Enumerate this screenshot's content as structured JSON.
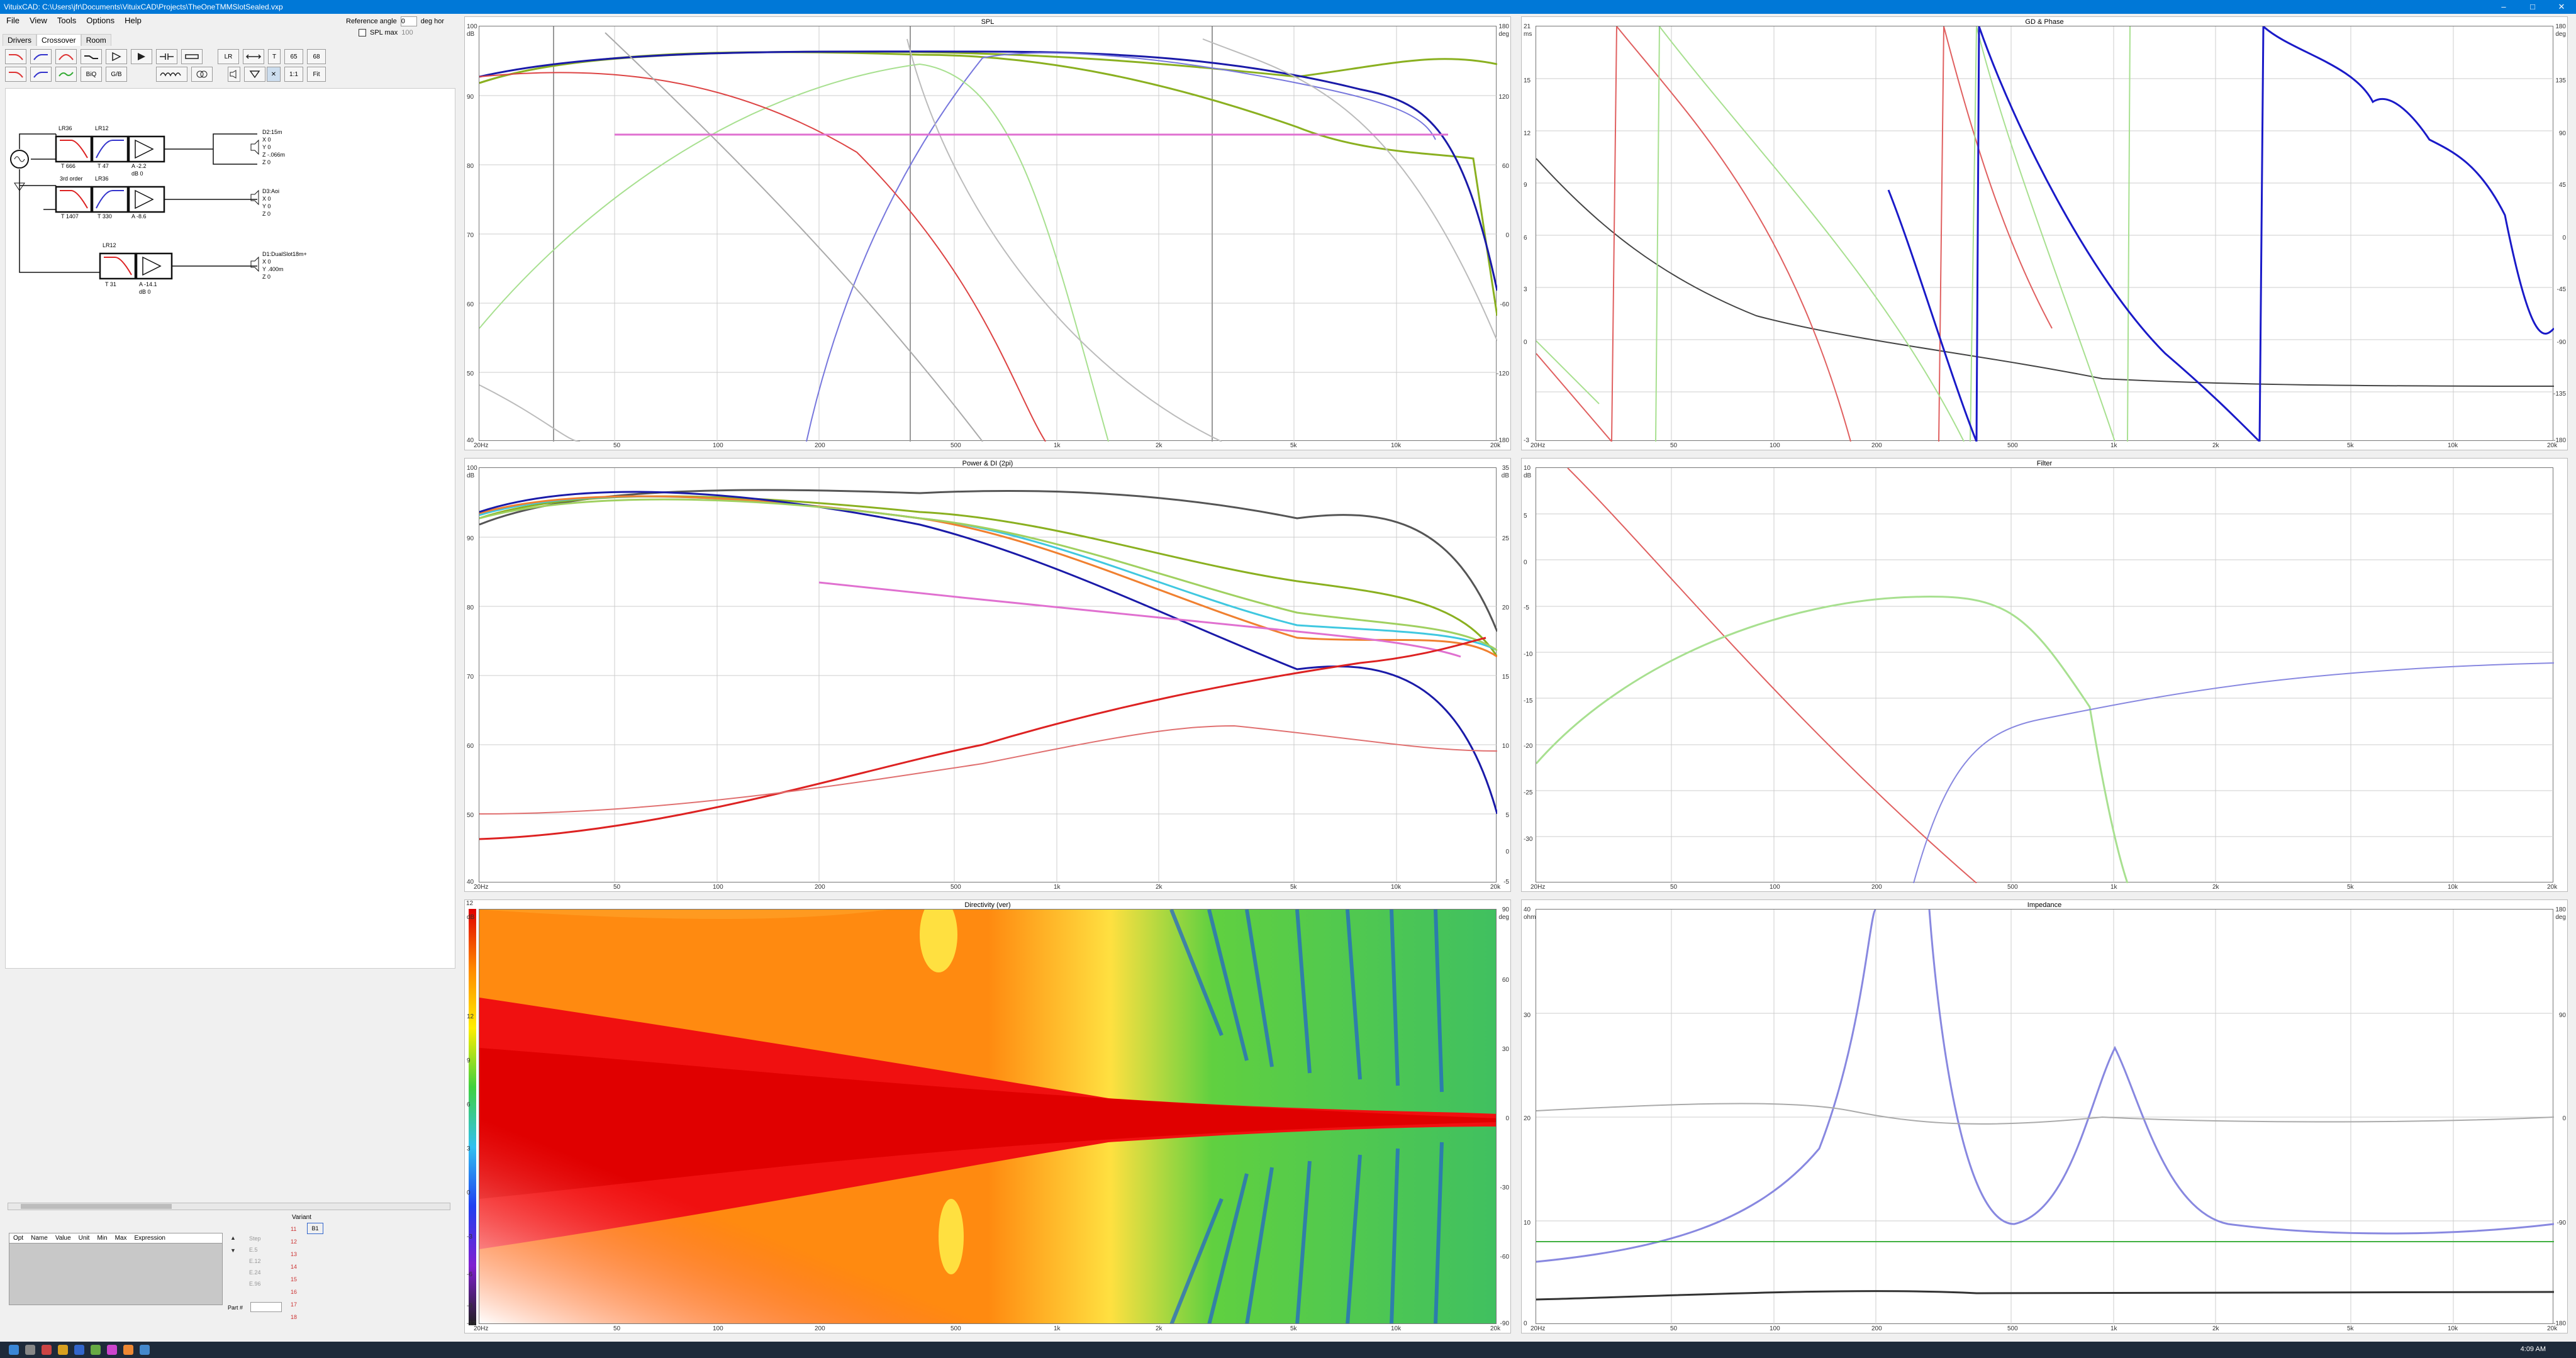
{
  "app": {
    "title": "VituixCAD: C:\\Users\\jfr\\Documents\\VituixCAD\\Projects\\TheOneTMMSlotSealed.vxp",
    "window_controls": [
      "–",
      "□",
      "✕"
    ]
  },
  "menu": [
    "File",
    "View",
    "Tools",
    "Options",
    "Help"
  ],
  "ref": {
    "label": "Reference angle",
    "value": "0",
    "unit": "deg hor"
  },
  "spl_max": {
    "label": "SPL max",
    "value": "100"
  },
  "tabs": [
    "Drivers",
    "Crossover",
    "Room"
  ],
  "toolbar": {
    "lr_label": "LR",
    "b1": "65",
    "b2": "68",
    "b3": "1:1",
    "b4": "Fit"
  },
  "circuit": {
    "blocks": [
      "LR36",
      "LR12",
      "LR36",
      "LR12",
      "LR12"
    ],
    "drivers": [
      {
        "name": "D2:15m",
        "x": "X 0",
        "y": "Y 0",
        "z": "Z -.066m",
        "w": "Z 0"
      },
      {
        "name": "D3:Aoi",
        "x": "X 0",
        "y": "Y 0",
        "z": "Z 0",
        "w": "Z 0"
      },
      {
        "name": "D1:DualSlot18m+",
        "x": "X 0",
        "y": "Y .400m",
        "z": "Z 0",
        "w": ""
      }
    ],
    "params": [
      "T 666",
      "T 47",
      "A -2.2",
      "T 1407",
      "T 330",
      "A -8.6",
      "T 31",
      "A -14.1",
      "3rd order",
      "dB 0",
      "dB 0"
    ]
  },
  "optim": {
    "headers": [
      "Opt",
      "Name",
      "Value",
      "Unit",
      "Min",
      "Max",
      "Expression"
    ],
    "steps": [
      "Step",
      "E.5",
      "E.12",
      "E.24",
      "E.96"
    ],
    "variant_label": "Variant",
    "variants": [
      "11",
      "12",
      "13",
      "14",
      "15",
      "16",
      "17",
      "18"
    ],
    "variant_side": "B1",
    "part_label": "Part #"
  },
  "graphs": {
    "spl": {
      "title": "SPL",
      "yl": [
        "100",
        "dB",
        "90",
        "80",
        "70",
        "60",
        "50",
        "40"
      ],
      "yr": [
        "180",
        "deg",
        "120",
        "60",
        "0",
        "-60",
        "-120",
        "-180"
      ]
    },
    "gd": {
      "title": "GD & Phase",
      "yl": [
        "21",
        "ms",
        "15",
        "12",
        "9",
        "6",
        "3",
        "0",
        "-3"
      ],
      "yr": [
        "180",
        "deg",
        "135",
        "90",
        "45",
        "0",
        "-45",
        "-90",
        "-135",
        "-180"
      ]
    },
    "power": {
      "title": "Power & DI (2pi)",
      "yl": [
        "100",
        "dB",
        "90",
        "80",
        "70",
        "60",
        "50",
        "40"
      ],
      "yr": [
        "35",
        "dB",
        "25",
        "20",
        "15",
        "10",
        "5",
        "0",
        "-5"
      ]
    },
    "filter": {
      "title": "Filter",
      "yl": [
        "10",
        "dB",
        "5",
        "0",
        "-5",
        "-10",
        "-15",
        "-20",
        "-25",
        "-30"
      ]
    },
    "dir": {
      "title": "Directivity (ver)",
      "yl": [
        "12",
        "dB",
        "12",
        "9",
        "6",
        "3",
        "0",
        "-3",
        "-6",
        "-9",
        "-12"
      ],
      "yr": [
        "90",
        "deg",
        "60",
        "30",
        "0",
        "-30",
        "-60",
        "-90"
      ]
    },
    "imp": {
      "title": "Impedance",
      "yl": [
        "40",
        "ohm",
        "30",
        "20",
        "10",
        "0"
      ],
      "yr": [
        "180",
        "deg",
        "90",
        "0",
        "-90",
        "-180"
      ]
    },
    "xt": [
      "20Hz",
      "50",
      "100",
      "200",
      "500",
      "1k",
      "2k",
      "5k",
      "10k",
      "20k"
    ]
  },
  "taskbar": {
    "time": "4:09 AM"
  },
  "colors": {
    "titlebar": "#0078d7",
    "navy": "#1a1aa8",
    "olive": "#8ab020",
    "green": "#8ad060",
    "red": "#d43030",
    "pink": "#e070d0"
  }
}
